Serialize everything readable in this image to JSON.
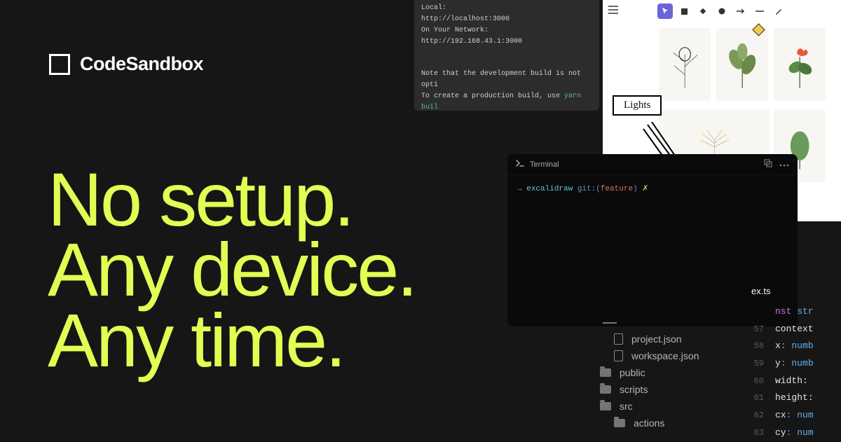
{
  "brand": {
    "name": "CodeSandbox"
  },
  "hero": {
    "line1": "No setup.",
    "line2": "Any device.",
    "line3": "Any time."
  },
  "devTerminal": {
    "local_label": "Local:",
    "local_url": "http://localhost:3000",
    "network_label": "On Your Network:",
    "network_url": "http://192.168.43.1:3000",
    "note_line1": "Note that the development build is not opti",
    "note_line2": "To create a production build, use ",
    "yarn_cmd": "yarn buil"
  },
  "drawing": {
    "lights_label": "Lights",
    "tools": [
      "pointer",
      "square",
      "diamond",
      "circle",
      "arrow",
      "line",
      "draw"
    ]
  },
  "terminal": {
    "title": "Terminal",
    "prompt": {
      "arrow": "→",
      "dir": "excalidraw",
      "git_label": "git:(",
      "branch": "feature",
      "git_close": ")",
      "dirty": "✗"
    }
  },
  "fileTree": {
    "items": [
      {
        "type": "file",
        "name": "project.json"
      },
      {
        "type": "file",
        "name": "workspace.json"
      },
      {
        "type": "folder",
        "name": "public"
      },
      {
        "type": "folder",
        "name": "scripts"
      },
      {
        "type": "folder",
        "name": "src"
      },
      {
        "type": "folder",
        "name": "actions"
      }
    ]
  },
  "editor": {
    "tab": "ex.ts",
    "lines": [
      {
        "n": "",
        "kw": "nst",
        "type": " str"
      },
      {
        "n": "57",
        "prop": "context",
        "rest": ""
      },
      {
        "n": "58",
        "prop": "x",
        "rest": ": numb"
      },
      {
        "n": "59",
        "prop": "y",
        "rest": ": numb"
      },
      {
        "n": "60",
        "prop": "width",
        "rest": ":"
      },
      {
        "n": "61",
        "prop": "height",
        "rest": ":"
      },
      {
        "n": "62",
        "prop": "cx",
        "rest": ": num"
      },
      {
        "n": "63",
        "prop": "cy",
        "rest": ": num"
      }
    ]
  }
}
